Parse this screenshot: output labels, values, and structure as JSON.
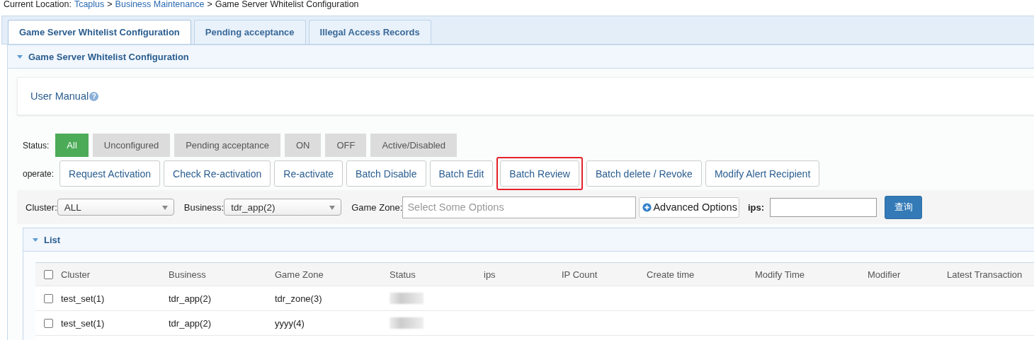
{
  "breadcrumb": {
    "label": "Current Location:",
    "links": [
      "Tcaplus",
      "Business Maintenance"
    ],
    "separator": ">",
    "current": "Game Server Whitelist Configuration"
  },
  "tabs": [
    {
      "label": "Game Server Whitelist Configuration",
      "selected": true
    },
    {
      "label": "Pending acceptance",
      "selected": false
    },
    {
      "label": "Illegal Access Records",
      "selected": false
    }
  ],
  "panel": {
    "title": "Game Server Whitelist Configuration",
    "expanded": true
  },
  "user_manual": "User Manual",
  "help_icon": "?",
  "status_filter": {
    "label": "Status:",
    "options": [
      {
        "label": "All",
        "selected": true
      },
      {
        "label": "Unconfigured",
        "selected": false
      },
      {
        "label": "Pending acceptance",
        "selected": false
      },
      {
        "label": "ON",
        "selected": false
      },
      {
        "label": "OFF",
        "selected": false
      },
      {
        "label": "Active/Disabled",
        "selected": false
      }
    ]
  },
  "operate": {
    "label": "operate:",
    "buttons": [
      {
        "label": "Request Activation",
        "highlighted": false
      },
      {
        "label": "Check Re-activation",
        "highlighted": false
      },
      {
        "label": "Re-activate",
        "highlighted": false
      },
      {
        "label": "Batch Disable",
        "highlighted": false
      },
      {
        "label": "Batch Edit",
        "highlighted": false
      },
      {
        "label": "Batch Review",
        "highlighted": true
      },
      {
        "label": "Batch delete / Revoke",
        "highlighted": false
      },
      {
        "label": "Modify Alert Recipient",
        "highlighted": false
      }
    ]
  },
  "filters": {
    "cluster": {
      "label": "Cluster:",
      "value": "ALL"
    },
    "business": {
      "label": "Business:",
      "value": "tdr_app(2)"
    },
    "game_zone": {
      "label": "Game Zone:",
      "placeholder": "Select Some Options"
    },
    "advanced": "Advanced Options",
    "ips": {
      "label": "ips:"
    },
    "search_button": "查询"
  },
  "list": {
    "title": "List",
    "expanded": true,
    "all_checked": false,
    "columns": [
      "Cluster",
      "Business",
      "Game Zone",
      "Status",
      "ips",
      "IP Count",
      "Create time",
      "Modify Time",
      "Modifier",
      "Latest Transaction"
    ],
    "rows": [
      {
        "checked": false,
        "cells": [
          "test_set(1)",
          "tdr_app(2)",
          "tdr_zone(3)"
        ]
      },
      {
        "checked": false,
        "cells": [
          "test_set(1)",
          "tdr_app(2)",
          "yyyy(4)"
        ]
      }
    ]
  }
}
